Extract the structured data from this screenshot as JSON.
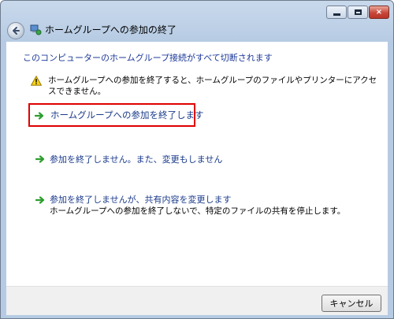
{
  "window": {
    "title": "ホームグループへの参加の終了",
    "controls": {
      "minimize": "minimize-icon",
      "maximize": "maximize-icon",
      "close": "×"
    }
  },
  "content": {
    "heading": "このコンピューターのホームグループ接続がすべて切断されます",
    "warning": "ホームグループへの参加を終了すると、ホームグループのファイルやプリンターにアクセスできません。",
    "options": [
      {
        "label": "ホームグループへの参加を終了します"
      },
      {
        "label": "参加を終了しません。また、変更もしません"
      },
      {
        "label": "参加を終了しませんが、共有内容を変更します",
        "description": "ホームグループへの参加を終了しないで、特定のファイルの共有を停止します。"
      }
    ]
  },
  "footer": {
    "cancel_label": "キャンセル"
  },
  "colors": {
    "link_blue": "#1a3a8a",
    "heading_blue": "#1e3a9a",
    "highlight_red": "#e00000",
    "arrow_green": "#2e9e2e"
  }
}
